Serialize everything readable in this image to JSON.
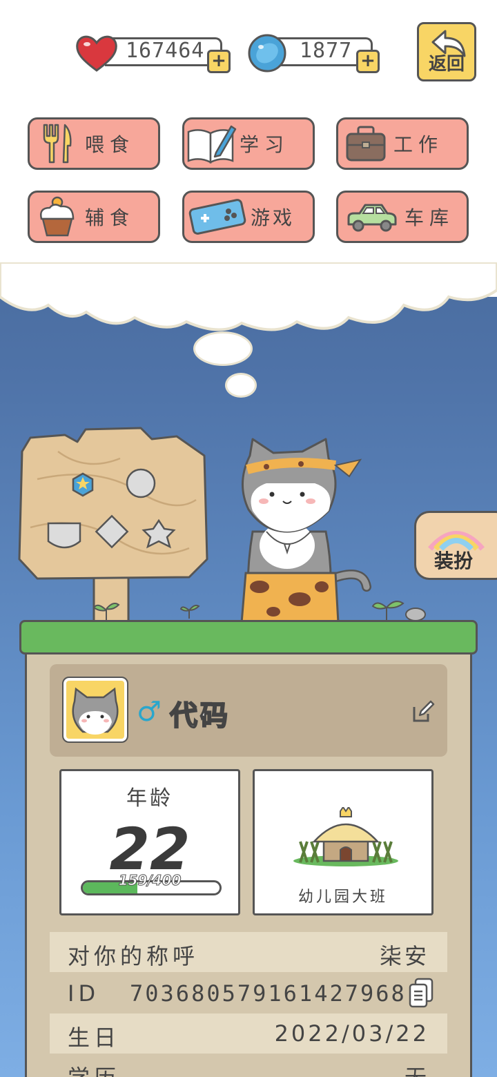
{
  "currency": {
    "hearts": "167464",
    "gems": "1877",
    "plus": "+"
  },
  "back_button": {
    "label": "返回"
  },
  "menu": [
    {
      "label": "喂食",
      "icon": "fork-knife-icon"
    },
    {
      "label": "学习",
      "icon": "book-pen-icon"
    },
    {
      "label": "工作",
      "icon": "briefcase-icon"
    },
    {
      "label": "辅食",
      "icon": "cupcake-icon"
    },
    {
      "label": "游戏",
      "icon": "gamepad-icon"
    },
    {
      "label": "车库",
      "icon": "car-icon"
    }
  ],
  "dress_up": {
    "label": "装扮"
  },
  "profile": {
    "gender_symbol": "♂",
    "name": "代码"
  },
  "age_card": {
    "title": "年龄",
    "age": "22",
    "exp_text": "159/400",
    "exp_progress": 0.3975
  },
  "school_card": {
    "label": "幼儿园大班"
  },
  "info": {
    "nickname_key": "对你的称呼",
    "nickname_val": "柒安",
    "id_key": "ID",
    "id_val": "703680579161427968",
    "birthday_key": "生日",
    "birthday_val": "2022/03/22",
    "education_key": "学历",
    "education_val": "无"
  },
  "colors": {
    "menu_button": "#f7a79a",
    "accent_yellow": "#f8d565",
    "grass": "#69b95e",
    "panel": "#d4c7ad"
  }
}
